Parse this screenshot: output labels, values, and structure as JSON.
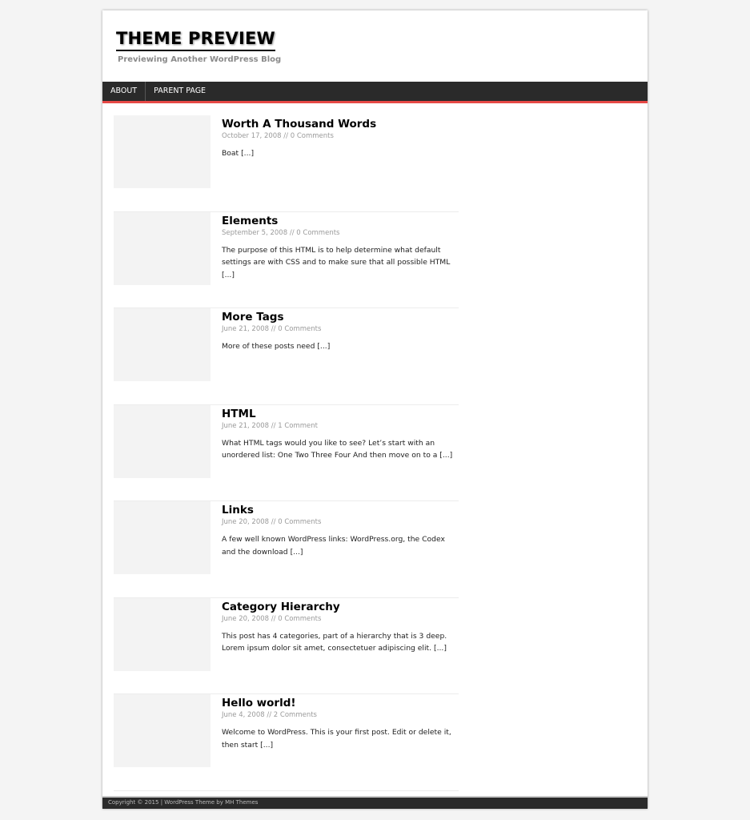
{
  "header": {
    "site_title": "THEME PREVIEW",
    "site_description": "Previewing Another WordPress Blog"
  },
  "nav": {
    "items": [
      {
        "label": "ABOUT"
      },
      {
        "label": "PARENT PAGE"
      }
    ]
  },
  "posts": [
    {
      "title": "Worth A Thousand Words",
      "date": "October 17, 2008",
      "separator": "//",
      "comments": "0 Comments",
      "excerpt": "Boat",
      "more": "[...]"
    },
    {
      "title": "Elements",
      "date": "September 5, 2008",
      "separator": "//",
      "comments": "0 Comments",
      "excerpt": "The purpose of this HTML is to help determine what default settings are with CSS and to make sure that all possible HTML",
      "more": "[...]"
    },
    {
      "title": "More Tags",
      "date": "June 21, 2008",
      "separator": "//",
      "comments": "0 Comments",
      "excerpt": "More of these posts need",
      "more": "[...]"
    },
    {
      "title": "HTML",
      "date": "June 21, 2008",
      "separator": "//",
      "comments": "1 Comment",
      "excerpt": "What HTML tags would you like to see? Let’s start with an unordered list: One Two Three Four And then move on to a",
      "more": "[...]"
    },
    {
      "title": "Links",
      "date": "June 20, 2008",
      "separator": "//",
      "comments": "0 Comments",
      "excerpt": "A few well known WordPress links: WordPress.org, the Codex and the download",
      "more": "[...]"
    },
    {
      "title": "Category Hierarchy",
      "date": "June 20, 2008",
      "separator": "//",
      "comments": "0 Comments",
      "excerpt": "This post has 4 categories, part of a hierarchy that is 3 deep. Lorem ipsum dolor sit amet, consectetuer adipiscing elit.",
      "more": "[...]"
    },
    {
      "title": "Hello world!",
      "date": "June 4, 2008",
      "separator": "//",
      "comments": "2 Comments",
      "excerpt": "Welcome to WordPress. This is your first post. Edit or delete it, then start",
      "more": "[...]"
    }
  ],
  "footer": {
    "text": "Copyright © 2015 | WordPress Theme by MH Themes"
  },
  "colors": {
    "page_background": "#f4f4f4",
    "nav_background": "#2a2a2a",
    "nav_accent": "#e64946",
    "thumbnail_placeholder": "#f3f3f3"
  }
}
